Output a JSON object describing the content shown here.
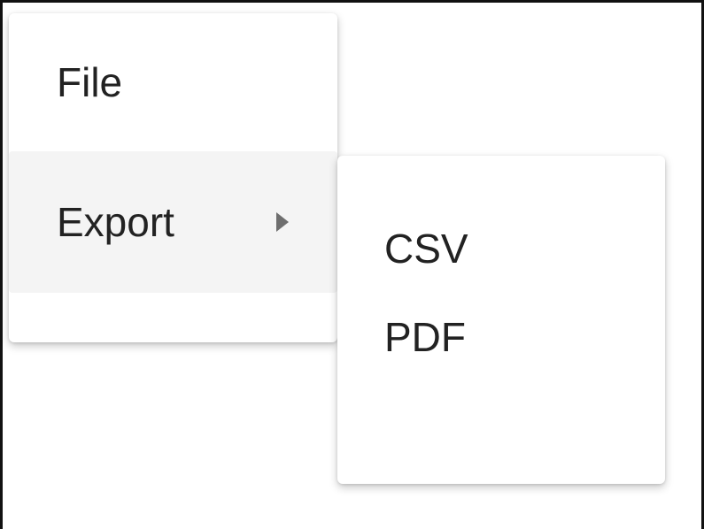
{
  "menu": {
    "items": [
      {
        "label": "File"
      },
      {
        "label": "Export",
        "has_submenu": true,
        "submenu_icon": "caret-right-icon"
      }
    ],
    "active_item": "Export"
  },
  "submenu": {
    "items": [
      {
        "label": "CSV"
      },
      {
        "label": "PDF"
      }
    ]
  },
  "colors": {
    "active_item_background": "#f4f4f4",
    "text": "#222222",
    "caret": "#6e6e6e"
  }
}
